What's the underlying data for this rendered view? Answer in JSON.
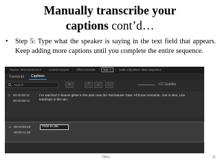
{
  "slide": {
    "title_bold_1": "Manually transcribe your",
    "title_bold_2": "captions",
    "title_rest": " cont’d…",
    "bullet": "Step 5: Type what the speaker is saying in the text field that appears. Keep adding more captions until you complete the entire sequence.",
    "footer": "Titles",
    "page_number": "11"
  },
  "app": {
    "menubar": {
      "items": [
        "Source: 2022.0210.0.0.0",
        "Lumetri Scopes",
        "Effect Controls",
        "Text",
        "Audio Clip Mixer: Main Sequence"
      ],
      "active_index": 3
    },
    "tabs": [
      "Transcript",
      "Captions"
    ],
    "active_tab": 1,
    "search_placeholder": "Search",
    "cc_label": "CC Subtitle",
    "captions": [
      {
        "index": "1.",
        "in": "00:00:05:11",
        "out": "00:00:08:13",
        "text": "I’ve watched C-beams glitter in the dark near the Tannhäuser Gate. All those moments...lost in time. Like teardrops in the rain."
      },
      {
        "index": "2.",
        "in": "00:00:08:19",
        "out": "00:00:11:18",
        "text": "Time to die."
      }
    ]
  }
}
